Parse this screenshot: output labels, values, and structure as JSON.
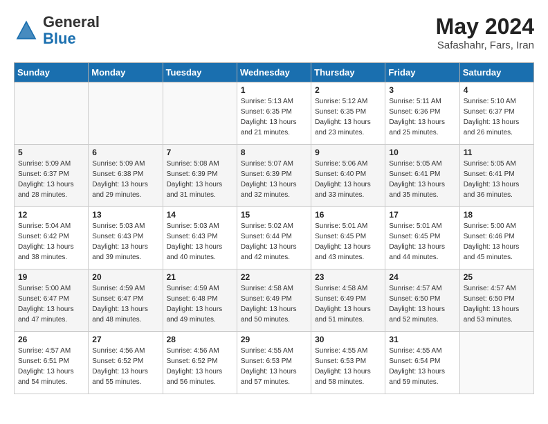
{
  "header": {
    "logo_line1": "General",
    "logo_line2": "Blue",
    "month_year": "May 2024",
    "location": "Safashahr, Fars, Iran"
  },
  "days_of_week": [
    "Sunday",
    "Monday",
    "Tuesday",
    "Wednesday",
    "Thursday",
    "Friday",
    "Saturday"
  ],
  "weeks": [
    [
      {
        "day": null,
        "sunrise": null,
        "sunset": null,
        "daylight": null
      },
      {
        "day": null,
        "sunrise": null,
        "sunset": null,
        "daylight": null
      },
      {
        "day": null,
        "sunrise": null,
        "sunset": null,
        "daylight": null
      },
      {
        "day": "1",
        "sunrise": "5:13 AM",
        "sunset": "6:35 PM",
        "daylight": "13 hours and 21 minutes."
      },
      {
        "day": "2",
        "sunrise": "5:12 AM",
        "sunset": "6:35 PM",
        "daylight": "13 hours and 23 minutes."
      },
      {
        "day": "3",
        "sunrise": "5:11 AM",
        "sunset": "6:36 PM",
        "daylight": "13 hours and 25 minutes."
      },
      {
        "day": "4",
        "sunrise": "5:10 AM",
        "sunset": "6:37 PM",
        "daylight": "13 hours and 26 minutes."
      }
    ],
    [
      {
        "day": "5",
        "sunrise": "5:09 AM",
        "sunset": "6:37 PM",
        "daylight": "13 hours and 28 minutes."
      },
      {
        "day": "6",
        "sunrise": "5:09 AM",
        "sunset": "6:38 PM",
        "daylight": "13 hours and 29 minutes."
      },
      {
        "day": "7",
        "sunrise": "5:08 AM",
        "sunset": "6:39 PM",
        "daylight": "13 hours and 31 minutes."
      },
      {
        "day": "8",
        "sunrise": "5:07 AM",
        "sunset": "6:39 PM",
        "daylight": "13 hours and 32 minutes."
      },
      {
        "day": "9",
        "sunrise": "5:06 AM",
        "sunset": "6:40 PM",
        "daylight": "13 hours and 33 minutes."
      },
      {
        "day": "10",
        "sunrise": "5:05 AM",
        "sunset": "6:41 PM",
        "daylight": "13 hours and 35 minutes."
      },
      {
        "day": "11",
        "sunrise": "5:05 AM",
        "sunset": "6:41 PM",
        "daylight": "13 hours and 36 minutes."
      }
    ],
    [
      {
        "day": "12",
        "sunrise": "5:04 AM",
        "sunset": "6:42 PM",
        "daylight": "13 hours and 38 minutes."
      },
      {
        "day": "13",
        "sunrise": "5:03 AM",
        "sunset": "6:43 PM",
        "daylight": "13 hours and 39 minutes."
      },
      {
        "day": "14",
        "sunrise": "5:03 AM",
        "sunset": "6:43 PM",
        "daylight": "13 hours and 40 minutes."
      },
      {
        "day": "15",
        "sunrise": "5:02 AM",
        "sunset": "6:44 PM",
        "daylight": "13 hours and 42 minutes."
      },
      {
        "day": "16",
        "sunrise": "5:01 AM",
        "sunset": "6:45 PM",
        "daylight": "13 hours and 43 minutes."
      },
      {
        "day": "17",
        "sunrise": "5:01 AM",
        "sunset": "6:45 PM",
        "daylight": "13 hours and 44 minutes."
      },
      {
        "day": "18",
        "sunrise": "5:00 AM",
        "sunset": "6:46 PM",
        "daylight": "13 hours and 45 minutes."
      }
    ],
    [
      {
        "day": "19",
        "sunrise": "5:00 AM",
        "sunset": "6:47 PM",
        "daylight": "13 hours and 47 minutes."
      },
      {
        "day": "20",
        "sunrise": "4:59 AM",
        "sunset": "6:47 PM",
        "daylight": "13 hours and 48 minutes."
      },
      {
        "day": "21",
        "sunrise": "4:59 AM",
        "sunset": "6:48 PM",
        "daylight": "13 hours and 49 minutes."
      },
      {
        "day": "22",
        "sunrise": "4:58 AM",
        "sunset": "6:49 PM",
        "daylight": "13 hours and 50 minutes."
      },
      {
        "day": "23",
        "sunrise": "4:58 AM",
        "sunset": "6:49 PM",
        "daylight": "13 hours and 51 minutes."
      },
      {
        "day": "24",
        "sunrise": "4:57 AM",
        "sunset": "6:50 PM",
        "daylight": "13 hours and 52 minutes."
      },
      {
        "day": "25",
        "sunrise": "4:57 AM",
        "sunset": "6:50 PM",
        "daylight": "13 hours and 53 minutes."
      }
    ],
    [
      {
        "day": "26",
        "sunrise": "4:57 AM",
        "sunset": "6:51 PM",
        "daylight": "13 hours and 54 minutes."
      },
      {
        "day": "27",
        "sunrise": "4:56 AM",
        "sunset": "6:52 PM",
        "daylight": "13 hours and 55 minutes."
      },
      {
        "day": "28",
        "sunrise": "4:56 AM",
        "sunset": "6:52 PM",
        "daylight": "13 hours and 56 minutes."
      },
      {
        "day": "29",
        "sunrise": "4:55 AM",
        "sunset": "6:53 PM",
        "daylight": "13 hours and 57 minutes."
      },
      {
        "day": "30",
        "sunrise": "4:55 AM",
        "sunset": "6:53 PM",
        "daylight": "13 hours and 58 minutes."
      },
      {
        "day": "31",
        "sunrise": "4:55 AM",
        "sunset": "6:54 PM",
        "daylight": "13 hours and 59 minutes."
      },
      {
        "day": null,
        "sunrise": null,
        "sunset": null,
        "daylight": null
      }
    ]
  ]
}
